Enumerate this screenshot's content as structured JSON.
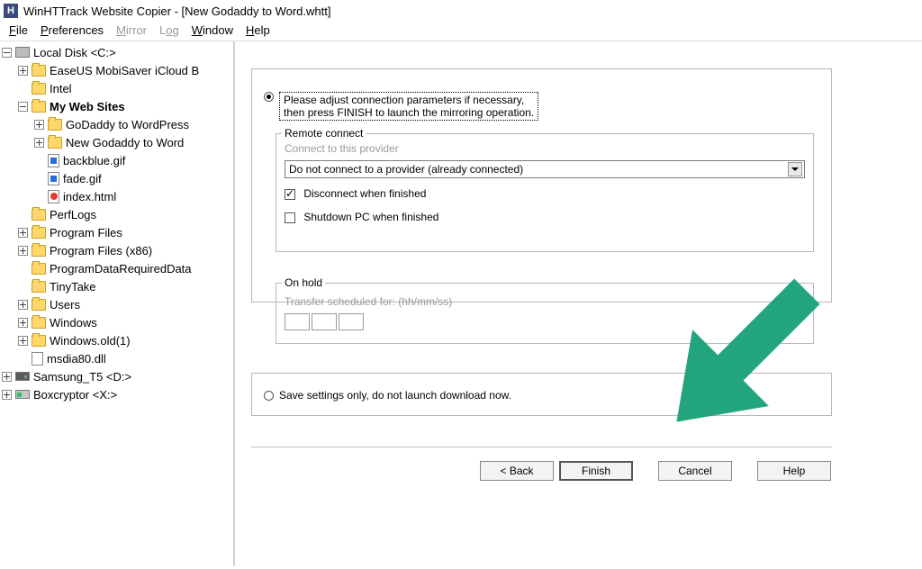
{
  "title": "WinHTTrack Website Copier - [New Godaddy to Word.whtt]",
  "menu": {
    "file": "File",
    "preferences": "Preferences",
    "mirror": "Mirror",
    "log": "Log",
    "window": "Window",
    "help": "Help"
  },
  "tree": {
    "root": "Local Disk <C:>",
    "easeus": "EaseUS MobiSaver iCloud B",
    "intel": "Intel",
    "mywebsites": "My Web Sites",
    "godaddywp": "GoDaddy to WordPress",
    "newgodaddy": "New Godaddy to Word",
    "backblue": "backblue.gif",
    "fade": "fade.gif",
    "index": "index.html",
    "perflogs": "PerfLogs",
    "progfiles": "Program Files",
    "progfiles86": "Program Files (x86)",
    "progdata": "ProgramDataRequiredData",
    "tinytake": "TinyTake",
    "users": "Users",
    "windows": "Windows",
    "windowsold": "Windows.old(1)",
    "msdia": "msdia80.dll",
    "samsung": "Samsung_T5 <D:>",
    "boxcryptor": "Boxcryptor <X:>"
  },
  "panel": {
    "instruction": "Please adjust connection parameters if necessary,\nthen press FINISH to launch the mirroring operation.",
    "remote": {
      "legend": "Remote connect",
      "hint": "Connect to this provider",
      "select": "Do not connect to a provider (already connected)",
      "disconnect": "Disconnect when finished",
      "shutdown": "Shutdown PC when finished"
    },
    "onhold": {
      "legend": "On hold",
      "hint": "Transfer scheduled for: (hh/mm/ss)"
    },
    "saveonly": "Save settings only, do not launch download now."
  },
  "buttons": {
    "back": "< Back",
    "finish": "Finish",
    "cancel": "Cancel",
    "help": "Help"
  },
  "arrow_color": "#22a57f"
}
